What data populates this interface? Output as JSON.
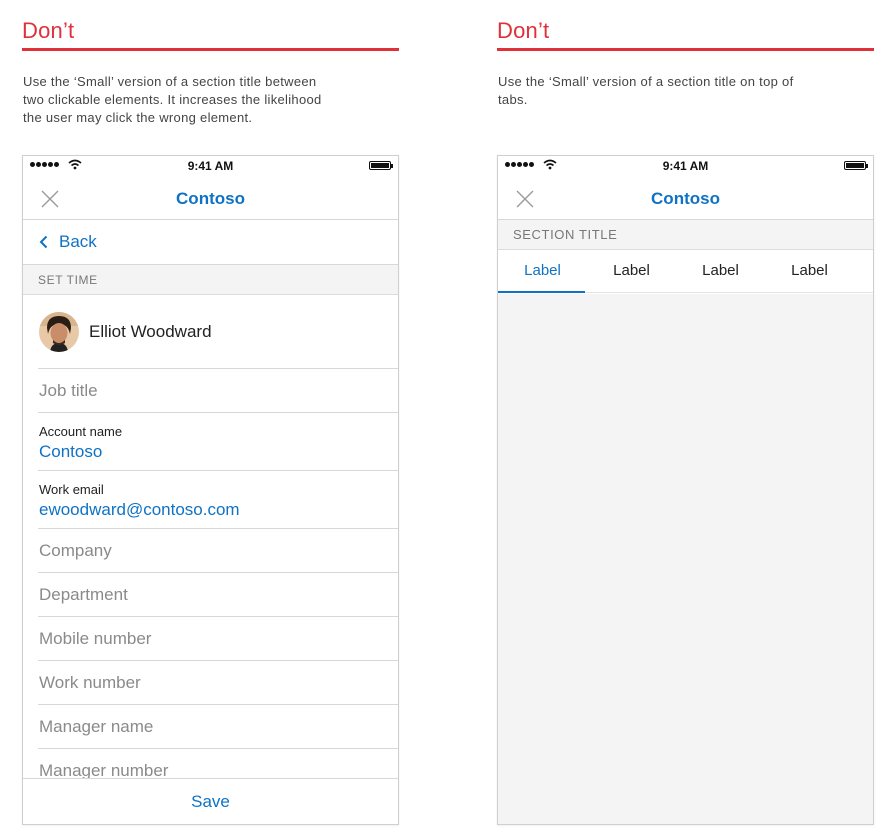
{
  "left": {
    "heading": "Don’t",
    "description_lines": [
      "Use the ‘Small’ version of a section title between",
      "two clickable elements. It increases the likelihood",
      "the user may click the wrong element."
    ],
    "status_time": "9:41 AM",
    "nav_title": "Contoso",
    "back_label": "Back",
    "section_title": "SET TIME",
    "person_name": "Elliot Woodward",
    "fields": {
      "job_title": "Job title",
      "account_label": "Account name",
      "account_value": "Contoso",
      "email_label": "Work email",
      "email_value": "ewoodward@contoso.com",
      "company": "Company",
      "department": "Department",
      "mobile": "Mobile number",
      "work_number": "Work number",
      "manager_name": "Manager name",
      "manager_number": "Manager number"
    },
    "save_label": "Save"
  },
  "right": {
    "heading": "Don’t",
    "description_lines": [
      "Use the ‘Small’ version of a section title on top of",
      "tabs."
    ],
    "status_time": "9:41 AM",
    "nav_title": "Contoso",
    "section_title": "SECTION TITLE",
    "tabs": [
      "Label",
      "Label",
      "Label",
      "Label"
    ],
    "active_tab_index": 0
  },
  "colors": {
    "warning_red": "#e0303a",
    "accent_blue": "#0f72c4",
    "section_gray": "#f4f4f4"
  },
  "icons": [
    "signal-dots-icon",
    "wifi-icon",
    "battery-icon",
    "close-icon",
    "chevron-left-icon"
  ]
}
